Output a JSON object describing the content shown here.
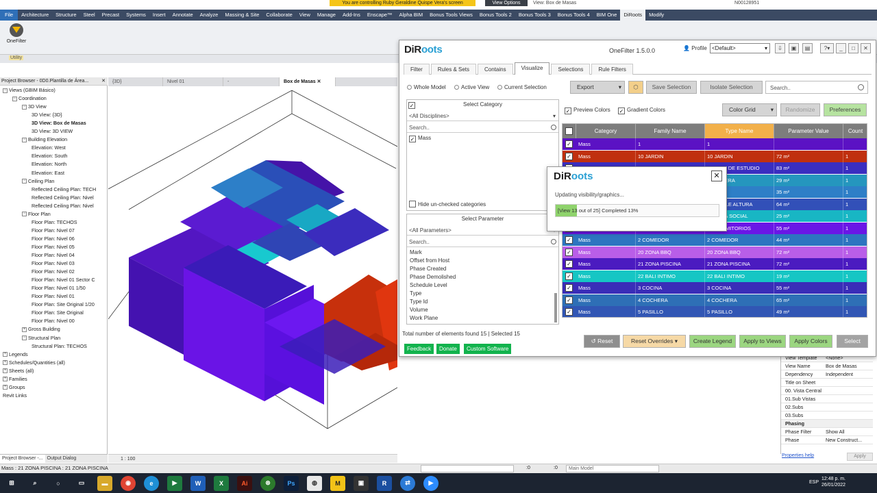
{
  "window": {
    "banner": "You are controlling Ruby Geraldine Quispe Vera's screen",
    "view_options": "View Options",
    "view_name": "View: Box de Masas",
    "user_id": "N00128951"
  },
  "ribbon": {
    "tabs": [
      "File",
      "Architecture",
      "Structure",
      "Steel",
      "Precast",
      "Systems",
      "Insert",
      "Annotate",
      "Analyze",
      "Massing & Site",
      "Collaborate",
      "View",
      "Manage",
      "Add-Ins",
      "Enscape™",
      "Alpha BIM",
      "Bonus Tools Views",
      "Bonus Tools 2",
      "Bonus Tools 3",
      "Bonus Tools 4",
      "BIM One",
      "DiRoots",
      "Modify"
    ],
    "active_tab": "DiRoots",
    "onefilter_label": "OneFilter",
    "panel_label": "Utility"
  },
  "project_browser": {
    "title": "Project Browser - 0D0.Plantilla de Área...",
    "nodes": [
      {
        "label": "Views (GBIM Básico)",
        "level": 0,
        "exp": "−"
      },
      {
        "label": "Coordination",
        "level": 1,
        "exp": "−"
      },
      {
        "label": "3D View",
        "level": 2,
        "exp": "−"
      },
      {
        "label": "3D View: {3D}",
        "level": 3
      },
      {
        "label": "3D View: Box de Masas",
        "level": 3,
        "bold": true
      },
      {
        "label": "3D View: 3D VIEW",
        "level": 3
      },
      {
        "label": "Building Elevation",
        "level": 2,
        "exp": "−"
      },
      {
        "label": "Elevation: West",
        "level": 3
      },
      {
        "label": "Elevation: South",
        "level": 3
      },
      {
        "label": "Elevation: North",
        "level": 3
      },
      {
        "label": "Elevation: East",
        "level": 3
      },
      {
        "label": "Ceiling Plan",
        "level": 2,
        "exp": "−"
      },
      {
        "label": "Reflected Ceiling Plan: TECH",
        "level": 3
      },
      {
        "label": "Reflected Ceiling Plan: Nivel",
        "level": 3
      },
      {
        "label": "Reflected Ceiling Plan: Nivel",
        "level": 3
      },
      {
        "label": "Floor Plan",
        "level": 2,
        "exp": "−"
      },
      {
        "label": "Floor Plan: TECHOS",
        "level": 3
      },
      {
        "label": "Floor Plan: Nivel 07",
        "level": 3
      },
      {
        "label": "Floor Plan: Nivel 06",
        "level": 3
      },
      {
        "label": "Floor Plan: Nivel 05",
        "level": 3
      },
      {
        "label": "Floor Plan: Nivel 04",
        "level": 3
      },
      {
        "label": "Floor Plan: Nivel 03",
        "level": 3
      },
      {
        "label": "Floor Plan: Nivel 02",
        "level": 3
      },
      {
        "label": "Floor Plan: Nivel 01 Sector C",
        "level": 3
      },
      {
        "label": "Floor Plan: Nivel 01 1/50",
        "level": 3
      },
      {
        "label": "Floor Plan: Nivel 01",
        "level": 3
      },
      {
        "label": "Floor Plan: Site Original 1/20",
        "level": 3
      },
      {
        "label": "Floor Plan: Site Original",
        "level": 3
      },
      {
        "label": "Floor Plan: Nivel 00",
        "level": 3
      },
      {
        "label": "Gross Building",
        "level": 2,
        "exp": "+"
      },
      {
        "label": "Structural Plan",
        "level": 2,
        "exp": "−"
      },
      {
        "label": "Structural Plan: TECHOS",
        "level": 3
      },
      {
        "label": "Legends",
        "level": 0,
        "exp": "+"
      },
      {
        "label": "Schedules/Quantities (all)",
        "level": 0,
        "exp": "+"
      },
      {
        "label": "Sheets (all)",
        "level": 0,
        "exp": "+"
      },
      {
        "label": "Families",
        "level": 0,
        "exp": "+"
      },
      {
        "label": "Groups",
        "level": 0,
        "exp": "+"
      },
      {
        "label": "Revit Links",
        "level": 0
      }
    ],
    "bottom_tabs": [
      "Project Browser -...",
      "Output Dialog"
    ]
  },
  "view_tabs": [
    "{3D}",
    "Nivel 01",
    "-",
    "Box de Masas"
  ],
  "view_scale": "1 : 100",
  "dialog": {
    "logo_a": "DiR",
    "logo_b": "oots",
    "title": "OneFilter 1.5.0.0",
    "profile_label": "Profile",
    "profile_value": "<Default>",
    "tabs": [
      "Filter",
      "Rules & Sets",
      "Contains",
      "Visualize",
      "Selections",
      "Rule Filters"
    ],
    "active_tab": "Visualize",
    "scope": [
      "Whole Model",
      "Active View",
      "Current Selection"
    ],
    "export_label": "Export",
    "save_selection": "Save Selection",
    "isolate_selection": "Isolate Selection",
    "search_placeholder": "Search..",
    "select_category": "Select Category",
    "all_disciplines": "<All Disciplines>",
    "search_small": "Search..",
    "category_item": "Mass",
    "hide_unchecked": "Hide un-checked categories",
    "select_parameter": "Select Parameter",
    "all_parameters": "<All Parameters>",
    "parameters": [
      "Mark",
      "Offset from Host",
      "Phase Created",
      "Phase Demolished",
      "Schedule Level",
      "Type",
      "Type Id",
      "Volume",
      "Work Plane"
    ],
    "preview_colors": "Preview Colors",
    "gradient_colors": "Gradient Colors",
    "color_grid": "Color Grid",
    "randomize": "Randomize",
    "preferences": "Preferences",
    "grid_headers": [
      "Category",
      "Family Name",
      "Type Name",
      "Parameter Value",
      "Count"
    ],
    "total_text": "Total number of elements found 15 | Selected 15",
    "buttons": {
      "reset": "Reset",
      "reset_overrides": "Reset Overrides",
      "create_legend": "Create Legend",
      "apply_to_views": "Apply to Views",
      "apply_colors": "Apply Colors",
      "select": "Select"
    },
    "links": [
      "Feedback",
      "Donate",
      "Custom Software"
    ]
  },
  "grid_rows": [
    {
      "cat": "Mass",
      "fam": "1",
      "type": "1",
      "val": "",
      "count": "",
      "color": "#5b12c4"
    },
    {
      "cat": "Mass",
      "fam": "10 JARDIN",
      "type": "10 JARDIN",
      "val": "72 m²",
      "count": "1",
      "color": "#c0300f"
    },
    {
      "cat": "Mass",
      "fam": "11 SALA DE ESTUDIO",
      "type": "11 SALA DE ESTUDIO",
      "val": "83 m²",
      "count": "1",
      "color": "#3a2ec0"
    },
    {
      "cat": "Mass",
      "fam": "12 GALERA",
      "type": "12 GALERA",
      "val": "29 m²",
      "count": "1",
      "color": "#2596be"
    },
    {
      "cat": "Mass",
      "fam": "13",
      "type": "13",
      "val": "35 m²",
      "count": "1",
      "color": "#2e7fc7"
    },
    {
      "cat": "Mass",
      "fam": "14 DOBLE ALTURA",
      "type": "14 DOBLE ALTURA",
      "val": "64 m²",
      "count": "1",
      "color": "#3250b8"
    },
    {
      "cat": "Mass",
      "fam": "15 AREA SOCIAL",
      "type": "15 AREA SOCIAL",
      "val": "25 m²",
      "count": "1",
      "color": "#18b6c4"
    },
    {
      "cat": "Mass",
      "fam": "16 DORMITORIOS",
      "type": "16 DORMITORIOS",
      "val": "55 m²",
      "count": "1",
      "color": "#6a16e6"
    },
    {
      "cat": "Mass",
      "fam": "2 COMEDOR",
      "type": "2 COMEDOR",
      "val": "44 m²",
      "count": "1",
      "color": "#2d75c0"
    },
    {
      "cat": "Mass",
      "fam": "20 ZONA BBQ",
      "type": "20 ZONA BBQ",
      "val": "72 m²",
      "count": "1",
      "color": "#b95ee8"
    },
    {
      "cat": "Mass",
      "fam": "21 ZONA PISCINA",
      "type": "21 ZONA PISCINA",
      "val": "72 m²",
      "count": "1",
      "color": "#4b1bc0"
    },
    {
      "cat": "Mass",
      "fam": "22 BALI INTIMO",
      "type": "22 BALI INTIMO",
      "val": "19 m²",
      "count": "1",
      "color": "#16c6c4"
    },
    {
      "cat": "Mass",
      "fam": "3 COCINA",
      "type": "3 COCINA",
      "val": "55 m²",
      "count": "1",
      "color": "#3a2db8"
    },
    {
      "cat": "Mass",
      "fam": "4 COCHERA",
      "type": "4 COCHERA",
      "val": "65 m²",
      "count": "1",
      "color": "#2e6fb6"
    },
    {
      "cat": "Mass",
      "fam": "5 PASILLO",
      "type": "5 PASILLO",
      "val": "49 m²",
      "count": "1",
      "color": "#3156b4"
    }
  ],
  "popup": {
    "logo_a": "DiR",
    "logo_b": "oots",
    "message": "Updating visibility/graphics...",
    "progress": "[View 13 out of 25] Completed 13%",
    "progress_fraction": 0.13
  },
  "properties": {
    "rows": [
      {
        "k": "View Template",
        "v": "<None>"
      },
      {
        "k": "View Name",
        "v": "Box de Masas"
      },
      {
        "k": "Dependency",
        "v": "Independent"
      },
      {
        "k": "Title on Sheet",
        "v": ""
      },
      {
        "k": "00. Vista Central",
        "v": ""
      },
      {
        "k": "01.Sub Vistas",
        "v": ""
      },
      {
        "k": "02.Subs",
        "v": ""
      },
      {
        "k": "03.Subs",
        "v": ""
      },
      {
        "k": "Phasing",
        "v": "",
        "hdr": true
      },
      {
        "k": "Phase Filter",
        "v": "Show All"
      },
      {
        "k": "Phase",
        "v": "New Construct..."
      }
    ],
    "help": "Properties help",
    "apply": "Apply"
  },
  "status": {
    "text": "Mass : 21 ZONA PISCINA : 21 ZONA PISCINA",
    "zero1": ":0",
    "zero2": ":0",
    "main_model": "Main Model"
  },
  "taskbar": {
    "time": "12:48 p. m.",
    "date": "26/01/2022",
    "lang": "ESP"
  }
}
